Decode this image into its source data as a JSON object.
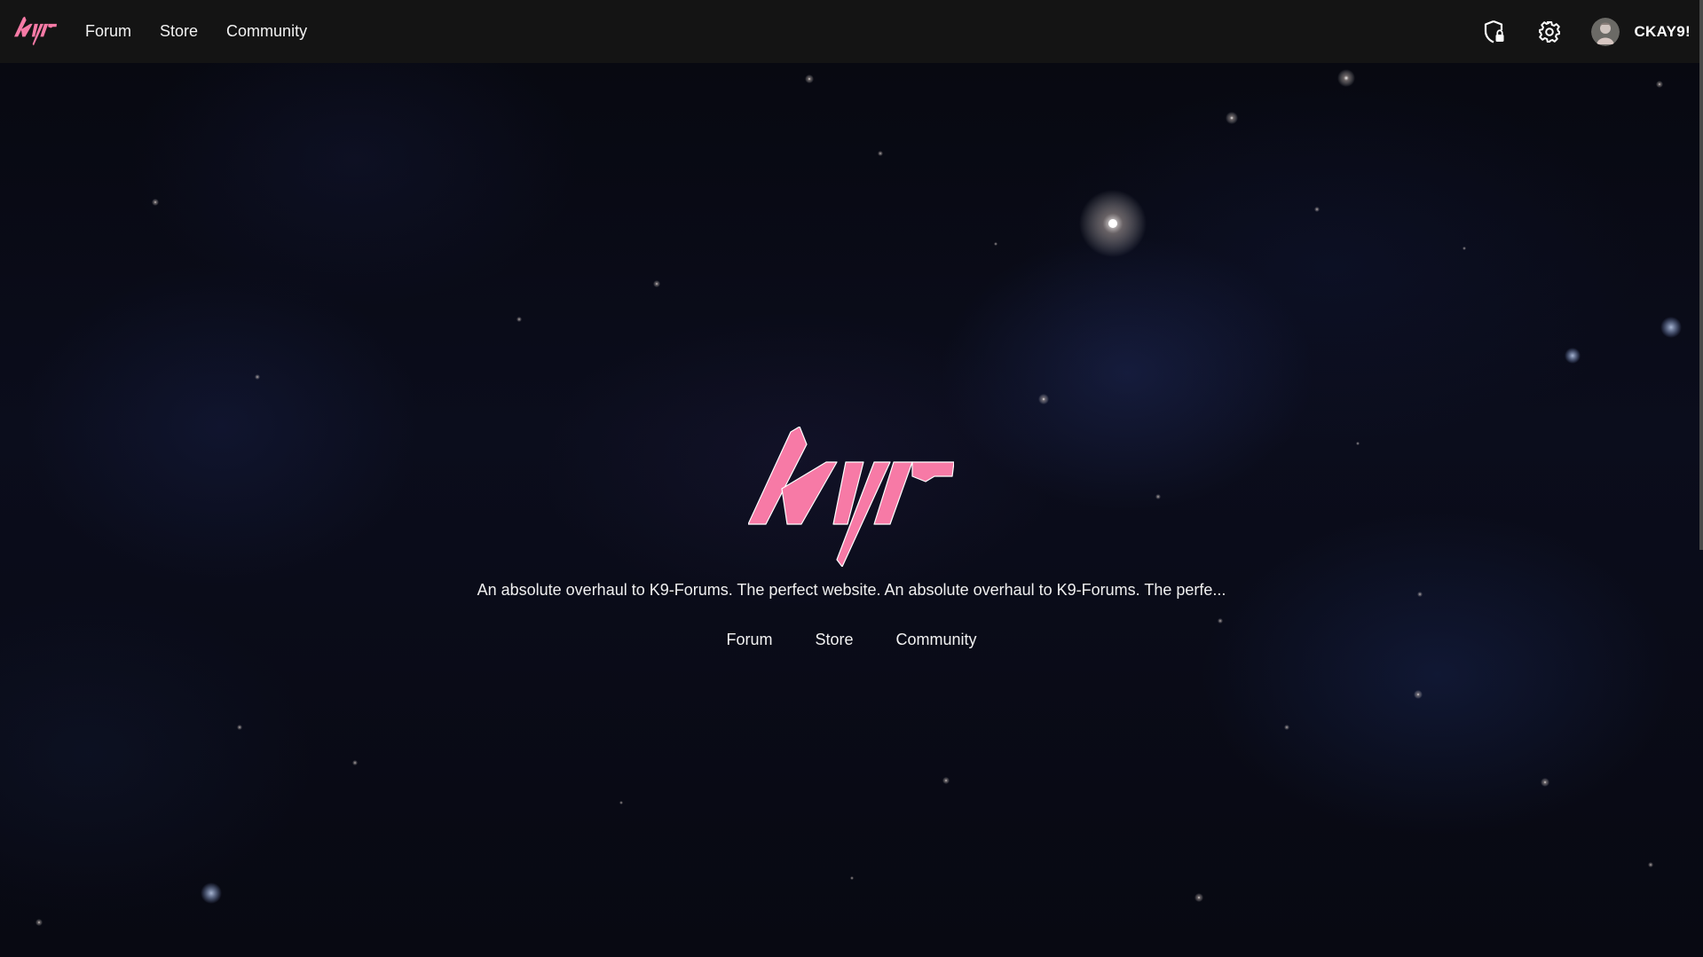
{
  "topbar": {
    "logo_text": "kyr",
    "nav": [
      "Forum",
      "Store",
      "Community"
    ],
    "username": "CKAY9!",
    "icons": [
      "shield-lock-icon",
      "gear-icon",
      "avatar"
    ]
  },
  "hero": {
    "logo_text": "kyr",
    "tagline": "An absolute overhaul to K9-Forums. The perfect website. An absolute overhaul to K9-Forums. The perfe...",
    "links": [
      "Forum",
      "Store",
      "Community"
    ]
  },
  "colors": {
    "brand_pink": "#f77aa6",
    "topbar_bg": "#141414",
    "text": "#f2f2f2"
  }
}
